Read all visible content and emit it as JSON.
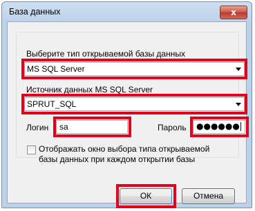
{
  "dialog": {
    "title": "База данных",
    "close_label": "x"
  },
  "db_type": {
    "label": "Выберите тип открываемой базы данных",
    "value": "MS SQL Server"
  },
  "source": {
    "label": "Источник данных MS SQL Server",
    "value": "SPRUT_SQL"
  },
  "login": {
    "label": "Логин",
    "value": "sa"
  },
  "password": {
    "label": "Пароль",
    "value": "●●●●●●"
  },
  "show_checkbox": {
    "checked": false,
    "label_line1": "Отображать окно выбора типа открываемой",
    "label_line2": "базы данных при каждом открытии базы"
  },
  "buttons": {
    "ok": "ОК",
    "cancel": "Отмена"
  },
  "colors": {
    "highlight": "#e3001b"
  }
}
